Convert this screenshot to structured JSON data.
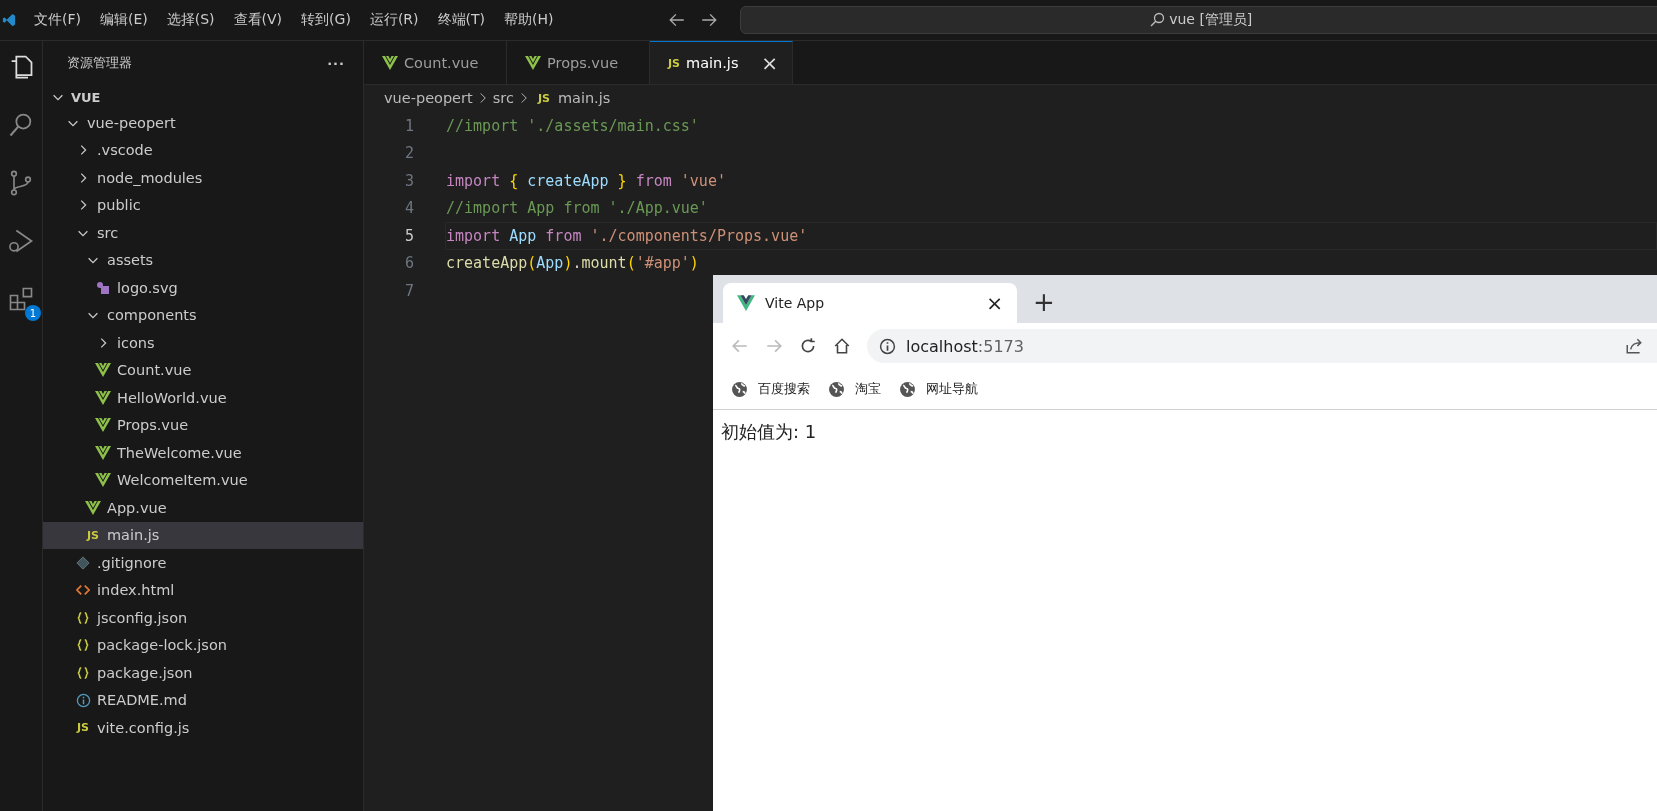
{
  "menu_bar": [
    "文件(F)",
    "编辑(E)",
    "选择(S)",
    "查看(V)",
    "转到(G)",
    "运行(R)",
    "终端(T)",
    "帮助(H)"
  ],
  "command_center": {
    "value": "vue [管理员]"
  },
  "activity_bar": {
    "extensions_badge": "1"
  },
  "explorer": {
    "title": "资源管理器",
    "more": "···",
    "root": "VUE",
    "tree": [
      {
        "label": "vue-peopert",
        "kind": "folder",
        "expanded": true,
        "selected": false,
        "children": [
          {
            "label": ".vscode",
            "kind": "folder",
            "expanded": false,
            "selected": false
          },
          {
            "label": "node_modules",
            "kind": "folder",
            "expanded": false,
            "selected": false
          },
          {
            "label": "public",
            "kind": "folder",
            "expanded": false,
            "selected": false
          },
          {
            "label": "src",
            "kind": "folder",
            "expanded": true,
            "selected": false,
            "children": [
              {
                "label": "assets",
                "kind": "folder",
                "expanded": true,
                "selected": false,
                "children": [
                  {
                    "label": "logo.svg",
                    "kind": "svg",
                    "selected": false
                  }
                ]
              },
              {
                "label": "components",
                "kind": "folder",
                "expanded": true,
                "selected": false,
                "children": [
                  {
                    "label": "icons",
                    "kind": "folder",
                    "expanded": false,
                    "selected": false
                  },
                  {
                    "label": "Count.vue",
                    "kind": "vue",
                    "selected": false
                  },
                  {
                    "label": "HelloWorld.vue",
                    "kind": "vue",
                    "selected": false
                  },
                  {
                    "label": "Props.vue",
                    "kind": "vue",
                    "selected": false
                  },
                  {
                    "label": "TheWelcome.vue",
                    "kind": "vue",
                    "selected": false
                  },
                  {
                    "label": "WelcomeItem.vue",
                    "kind": "vue",
                    "selected": false
                  }
                ]
              },
              {
                "label": "App.vue",
                "kind": "vue",
                "selected": false
              },
              {
                "label": "main.js",
                "kind": "js",
                "icon_text": "JS",
                "selected": true
              }
            ]
          },
          {
            "label": ".gitignore",
            "kind": "git",
            "selected": false
          },
          {
            "label": "index.html",
            "kind": "html",
            "selected": false
          },
          {
            "label": "jsconfig.json",
            "kind": "json",
            "selected": false
          },
          {
            "label": "package-lock.json",
            "kind": "json",
            "selected": false
          },
          {
            "label": "package.json",
            "kind": "json",
            "selected": false
          },
          {
            "label": "README.md",
            "kind": "info",
            "selected": false
          },
          {
            "label": "vite.config.js",
            "kind": "js",
            "icon_text": "JS",
            "selected": false
          }
        ]
      }
    ]
  },
  "editor_tabs": [
    {
      "label": "Count.vue",
      "kind": "vue",
      "selected": false
    },
    {
      "label": "Props.vue",
      "kind": "vue",
      "selected": false
    },
    {
      "label": "main.js",
      "kind": "js",
      "icon_text": "JS",
      "selected": true,
      "close": "×"
    }
  ],
  "breadcrumb": [
    {
      "label": "vue-peopert"
    },
    {
      "label": "src"
    },
    {
      "label": "main.js",
      "icon_text": "JS"
    }
  ],
  "code_lines": [
    {
      "number": "1",
      "current": false,
      "tokens": [
        {
          "t": "//import './assets/main.css'",
          "kind": "comment"
        }
      ]
    },
    {
      "number": "2",
      "current": false
    },
    {
      "number": "3",
      "current": false,
      "tokens": [
        {
          "t": "import ",
          "kind": "keyword"
        },
        {
          "t": "{",
          "kind": "bracket"
        },
        {
          "t": " createApp ",
          "kind": "var"
        },
        {
          "t": "}",
          "kind": "bracket"
        },
        {
          "t": " from",
          "kind": "keyword"
        },
        {
          "t": " 'vue'",
          "kind": "string"
        }
      ]
    },
    {
      "number": "4",
      "current": false,
      "tokens": [
        {
          "t": "//import App from './App.vue'",
          "kind": "comment"
        }
      ]
    },
    {
      "number": "5",
      "current": true,
      "tokens": [
        {
          "t": "import",
          "kind": "keyword"
        },
        {
          "t": " App ",
          "kind": "var"
        },
        {
          "t": "from",
          "kind": "keyword"
        },
        {
          "t": " './components/Props.vue'",
          "kind": "string"
        }
      ]
    },
    {
      "number": "6",
      "current": false,
      "tokens": [
        {
          "t": "createApp",
          "kind": "func"
        },
        {
          "t": "(",
          "kind": "bracket"
        },
        {
          "t": "App",
          "kind": "var"
        },
        {
          "t": ")",
          "kind": "bracket"
        },
        {
          "t": ".",
          "kind": "plain"
        },
        {
          "t": "mount",
          "kind": "func"
        },
        {
          "t": "(",
          "kind": "bracket"
        },
        {
          "t": "'#app'",
          "kind": "string"
        },
        {
          "t": ")",
          "kind": "bracket"
        }
      ]
    },
    {
      "number": "7",
      "current": false
    }
  ],
  "browser": {
    "tab": {
      "title": "Vite App",
      "close": "×"
    },
    "new_tab": "+",
    "address": {
      "host": "localhost",
      "port": ":5173"
    },
    "bookmarks": [
      "百度搜索",
      "淘宝",
      "网址导航"
    ],
    "page_text": "初始值为: 1"
  }
}
